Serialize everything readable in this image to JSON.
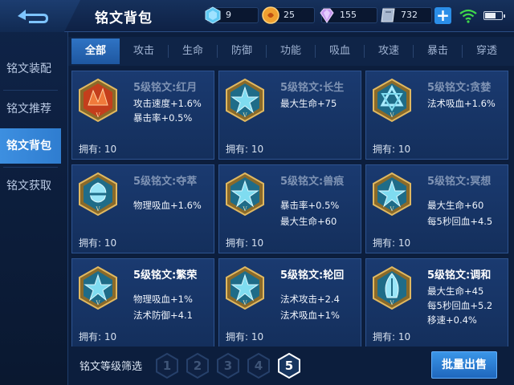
{
  "header": {
    "title": "铭文背包",
    "resources": [
      {
        "icon": "diamond-icon",
        "value": "9",
        "color": "#5ec8f2"
      },
      {
        "icon": "coin-icon",
        "value": "25",
        "color": "#f0a030"
      },
      {
        "icon": "gem-icon",
        "value": "155",
        "color": "#c89af0"
      },
      {
        "icon": "ticket-icon",
        "value": "732",
        "color": "#a8b8d0"
      }
    ],
    "plus_label": "+"
  },
  "sidebar": {
    "items": [
      {
        "label": "铭文装配",
        "active": false
      },
      {
        "label": "铭文推荐",
        "active": false
      },
      {
        "label": "铭文背包",
        "active": true
      },
      {
        "label": "铭文获取",
        "active": false
      }
    ]
  },
  "tabs": [
    {
      "label": "全部",
      "active": true
    },
    {
      "label": "攻击"
    },
    {
      "label": "生命"
    },
    {
      "label": "防御"
    },
    {
      "label": "功能"
    },
    {
      "label": "吸血"
    },
    {
      "label": "攻速"
    },
    {
      "label": "暴击"
    },
    {
      "label": "穿透"
    }
  ],
  "cards": [
    {
      "name": "5级铭文:红月",
      "stats": [
        "攻击速度+1.6%",
        "暴击率+0.5%"
      ],
      "owned": "拥有: 10",
      "emblem": "red-moon-icon",
      "color": "#d8502a",
      "bright": false
    },
    {
      "name": "5级铭文:长生",
      "stats": [
        "最大生命+75"
      ],
      "owned": "拥有: 10",
      "emblem": "longevity-icon",
      "color": "#4fb0c8",
      "bright": false
    },
    {
      "name": "5级铭文:贪婪",
      "stats": [
        "法术吸血+1.6%"
      ],
      "owned": "拥有: 10",
      "emblem": "greed-icon",
      "color": "#4fb0c8",
      "bright": false
    },
    {
      "name": "5级铭文:夺萃",
      "stats": [
        "物理吸血+1.6%"
      ],
      "owned": "拥有: 10",
      "emblem": "plunder-icon",
      "color": "#5fc0d8",
      "bright": false
    },
    {
      "name": "5级铭文:兽痕",
      "stats": [
        "暴击率+0.5%",
        "最大生命+60"
      ],
      "owned": "拥有: 10",
      "emblem": "beast-mark-icon",
      "color": "#4fb0c8",
      "bright": false
    },
    {
      "name": "5级铭文:冥想",
      "stats": [
        "最大生命+60",
        "每5秒回血+4.5"
      ],
      "owned": "拥有: 10",
      "emblem": "meditation-icon",
      "color": "#4fb0c8",
      "bright": false
    },
    {
      "name": "5级铭文:繁荣",
      "stats": [
        "物理吸血+1%",
        "法术防御+4.1"
      ],
      "owned": "拥有: 10",
      "emblem": "prosperity-icon",
      "color": "#4fb0c8",
      "bright": true
    },
    {
      "name": "5级铭文:轮回",
      "stats": [
        "法术攻击+2.4",
        "法术吸血+1%"
      ],
      "owned": "拥有: 10",
      "emblem": "reincarnation-icon",
      "color": "#4fb0c8",
      "bright": true
    },
    {
      "name": "5级铭文:调和",
      "stats": [
        "最大生命+45",
        "每5秒回血+5.2",
        "移速+0.4%"
      ],
      "owned": "拥有: 10",
      "emblem": "harmony-icon",
      "color": "#5fc0d8",
      "bright": true
    }
  ],
  "footer": {
    "filter_label": "铭文等级筛选",
    "levels": [
      "1",
      "2",
      "3",
      "4",
      "5"
    ],
    "active_level": "5",
    "sell_label": "批量出售"
  }
}
